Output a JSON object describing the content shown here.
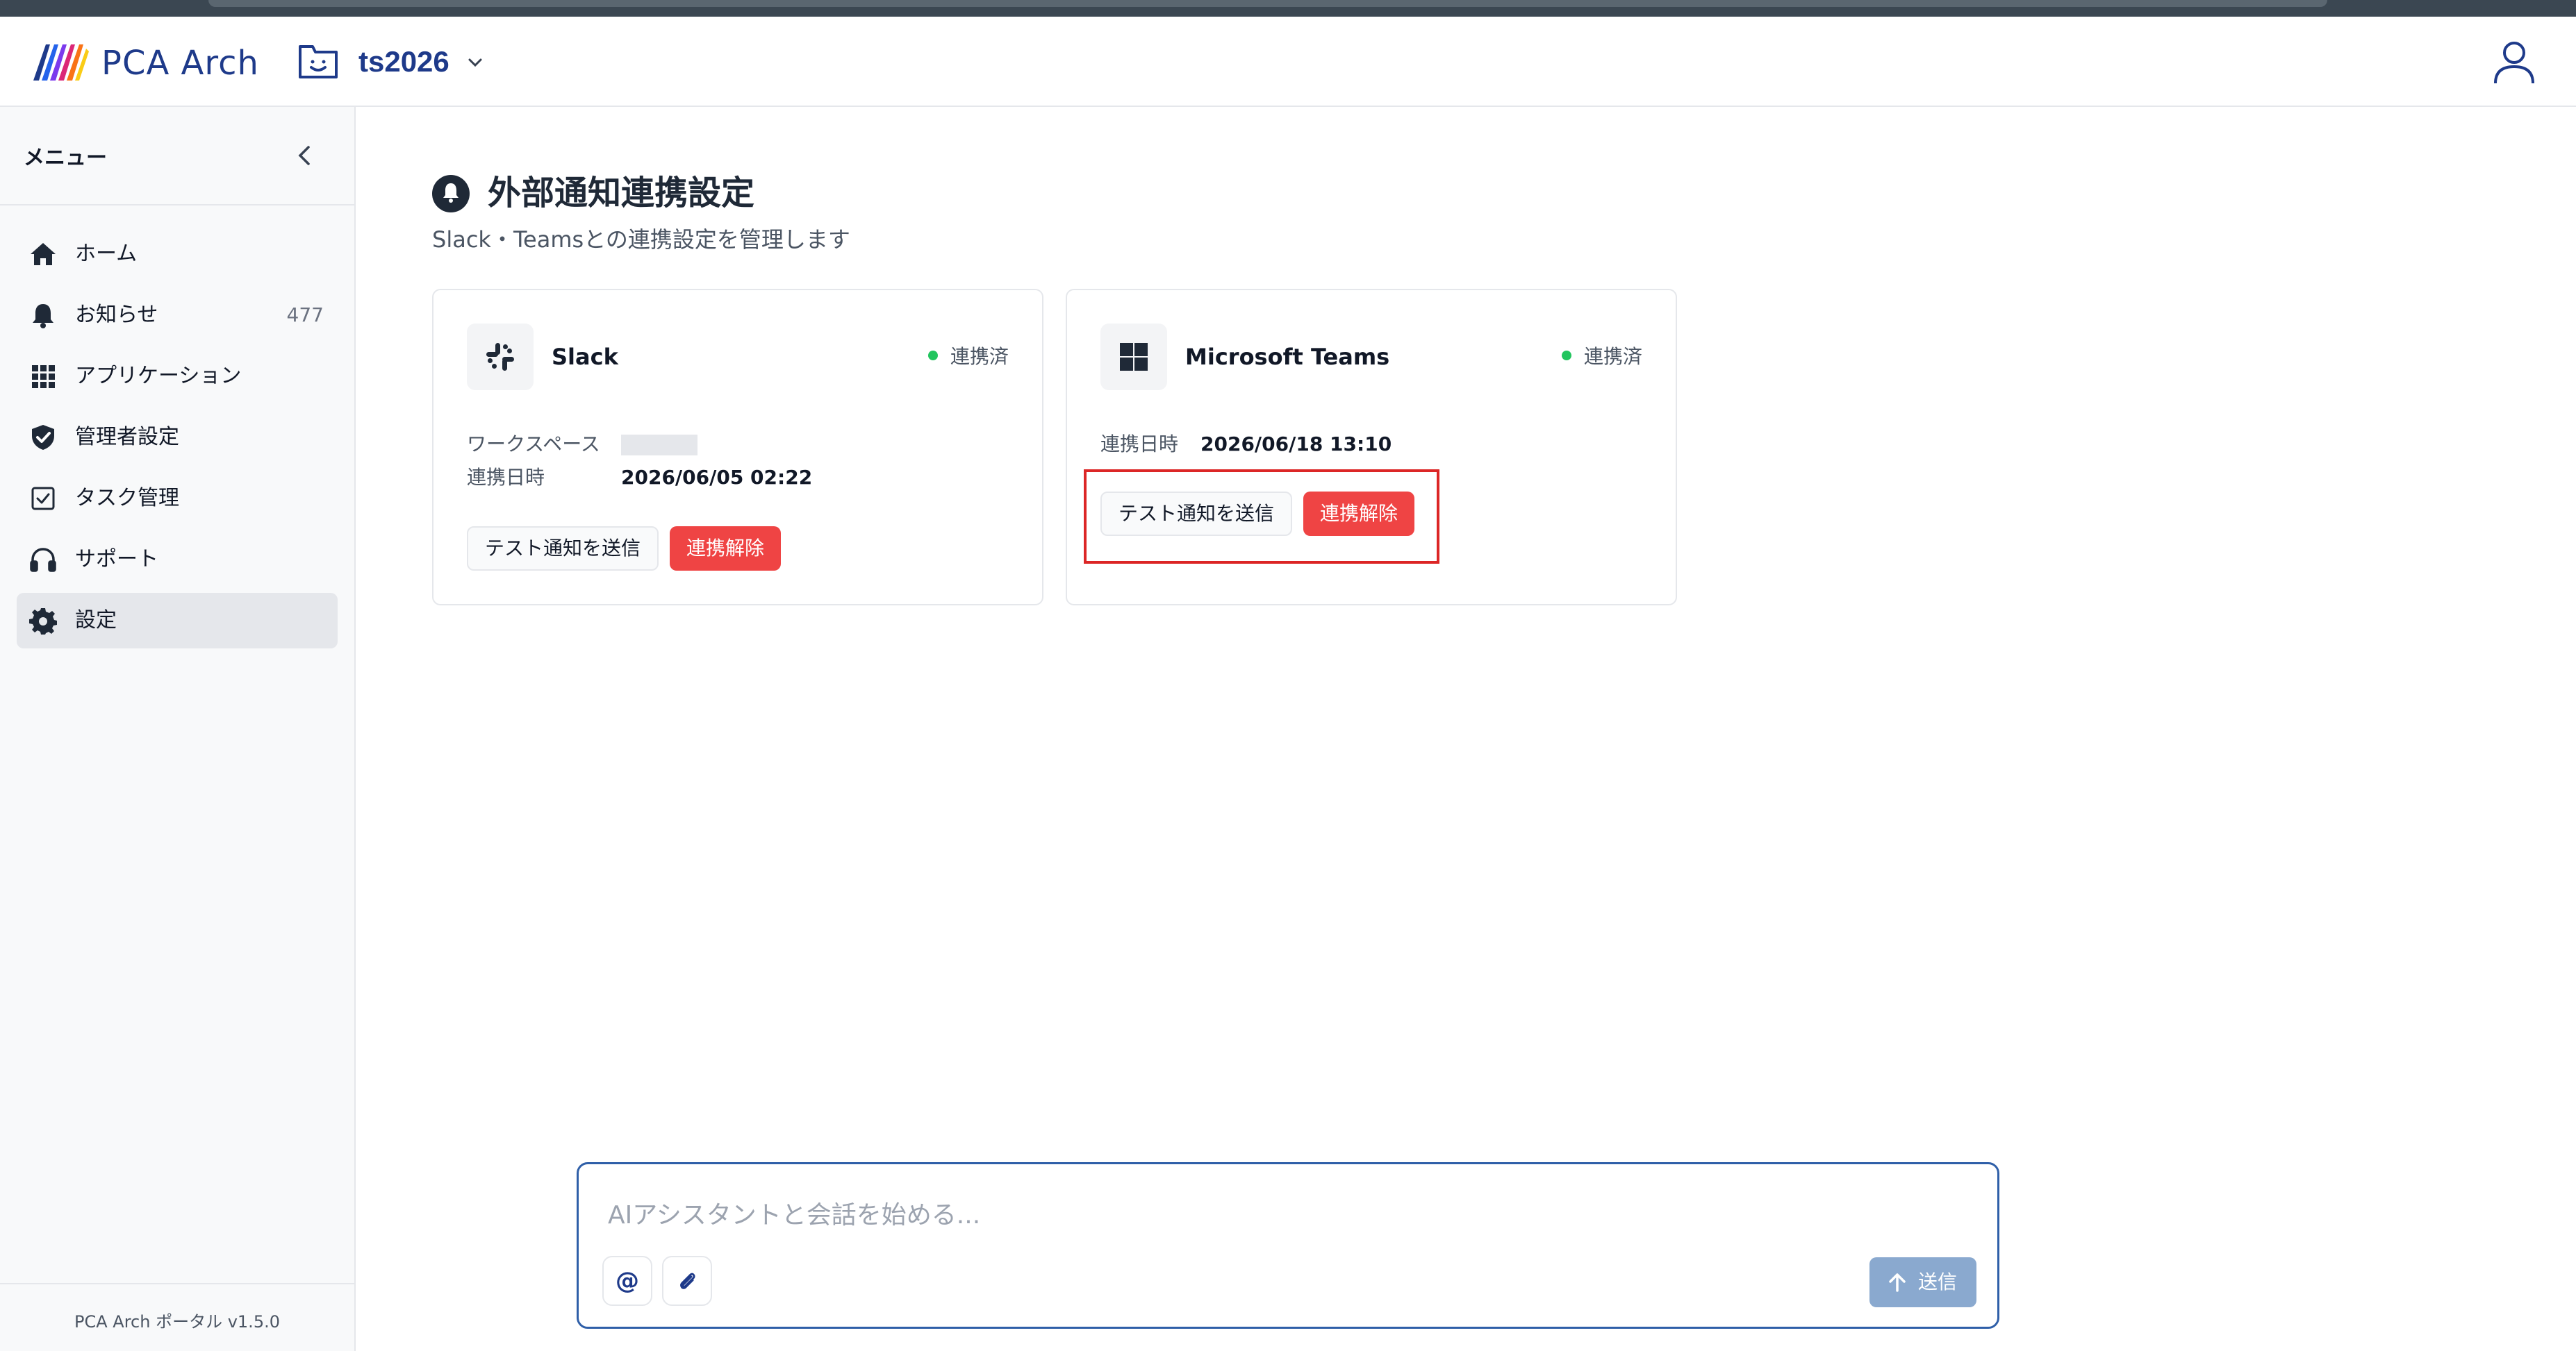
{
  "header": {
    "app_name": "PCA Arch",
    "project_name": "ts2026"
  },
  "sidebar": {
    "title": "メニュー",
    "items": [
      {
        "label": "ホーム",
        "icon": "home-icon"
      },
      {
        "label": "お知らせ",
        "icon": "bell-icon",
        "count": "477"
      },
      {
        "label": "アプリケーション",
        "icon": "grid-icon"
      },
      {
        "label": "管理者設定",
        "icon": "shield-icon"
      },
      {
        "label": "タスク管理",
        "icon": "checkbox-icon"
      },
      {
        "label": "サポート",
        "icon": "headphones-icon"
      },
      {
        "label": "設定",
        "icon": "gear-icon",
        "active": true
      }
    ],
    "version": "PCA Arch ポータル v1.5.0"
  },
  "main": {
    "title": "外部通知連携設定",
    "subtitle": "Slack・Teamsとの連携設定を管理します",
    "cards": [
      {
        "name": "Slack",
        "status": "連携済",
        "workspace_label": "ワークスペース",
        "linked_label": "連携日時",
        "linked_value": "2026/06/05 02:22",
        "test_button": "テスト通知を送信",
        "unlink_button": "連携解除"
      },
      {
        "name": "Microsoft Teams",
        "status": "連携済",
        "linked_label": "連携日時",
        "linked_value": "2026/06/18 13:10",
        "test_button": "テスト通知を送信",
        "unlink_button": "連携解除"
      }
    ]
  },
  "chat": {
    "placeholder": "AIアシスタントと会話を始める...",
    "mention_symbol": "@",
    "send_label": "送信"
  },
  "colors": {
    "brand": "#1e3a8a",
    "danger": "#ef4444",
    "status_ok": "#22c55e",
    "highlight": "#dc2626"
  }
}
